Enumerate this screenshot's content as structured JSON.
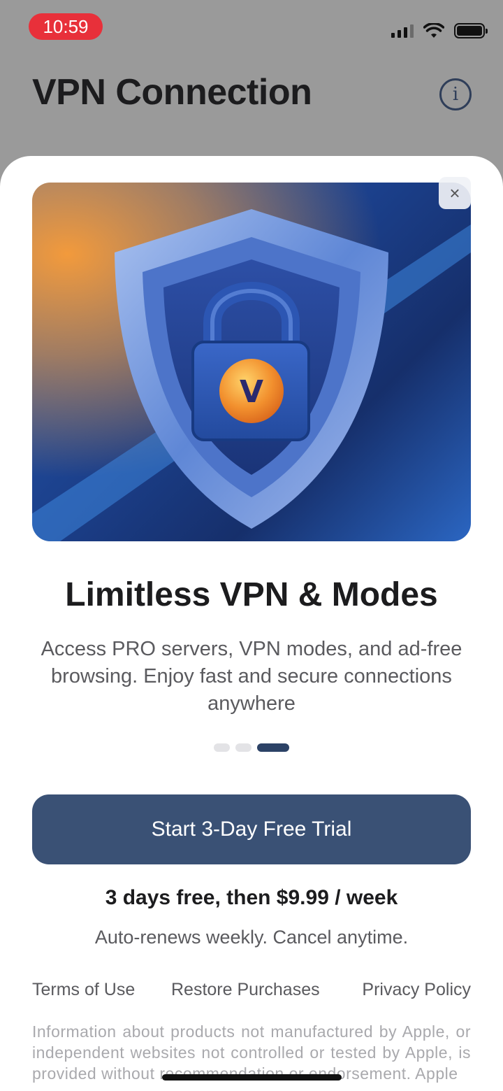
{
  "status_bar": {
    "time": "10:59"
  },
  "header": {
    "title": "VPN Connection",
    "info_icon": "info-icon"
  },
  "paywall": {
    "hero_image": "shield-lock-illustration",
    "logo_letter": "V",
    "close_icon": "×",
    "headline": "Limitless VPN & Modes",
    "subtitle": "Access PRO servers, VPN modes, and ad-free browsing. Enjoy fast and secure connections anywhere",
    "pager": {
      "pages": 3,
      "active": 3
    },
    "cta_label": "Start 3-Day Free Trial",
    "price_text": "3 days free, then $9.99 / week",
    "renew_text": "Auto-renews weekly. Cancel anytime.",
    "links": [
      "Terms of Use",
      "Restore Purchases",
      "Privacy Policy"
    ],
    "disclaimer": "Information about products not manufactured by Apple, or independent websites not controlled or tested by Apple, is provided without recommendation or endorsement. Apple"
  },
  "colors": {
    "time_pill": "#e8303a",
    "cta_background": "#3a5175",
    "pager_active": "#2c4266",
    "accent_orange": "#f29a3c"
  }
}
